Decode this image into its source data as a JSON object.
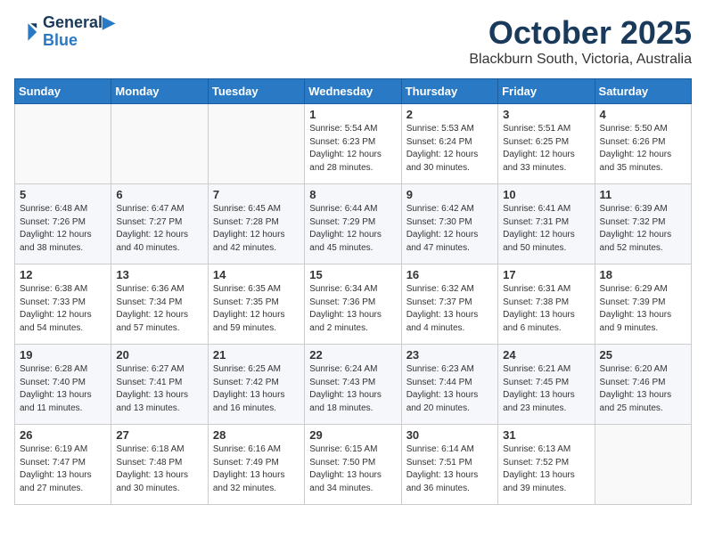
{
  "logo": {
    "line1": "General",
    "line2": "Blue"
  },
  "title": "October 2025",
  "location": "Blackburn South, Victoria, Australia",
  "weekdays": [
    "Sunday",
    "Monday",
    "Tuesday",
    "Wednesday",
    "Thursday",
    "Friday",
    "Saturday"
  ],
  "weeks": [
    [
      {
        "day": "",
        "info": ""
      },
      {
        "day": "",
        "info": ""
      },
      {
        "day": "",
        "info": ""
      },
      {
        "day": "1",
        "info": "Sunrise: 5:54 AM\nSunset: 6:23 PM\nDaylight: 12 hours\nand 28 minutes."
      },
      {
        "day": "2",
        "info": "Sunrise: 5:53 AM\nSunset: 6:24 PM\nDaylight: 12 hours\nand 30 minutes."
      },
      {
        "day": "3",
        "info": "Sunrise: 5:51 AM\nSunset: 6:25 PM\nDaylight: 12 hours\nand 33 minutes."
      },
      {
        "day": "4",
        "info": "Sunrise: 5:50 AM\nSunset: 6:26 PM\nDaylight: 12 hours\nand 35 minutes."
      }
    ],
    [
      {
        "day": "5",
        "info": "Sunrise: 6:48 AM\nSunset: 7:26 PM\nDaylight: 12 hours\nand 38 minutes."
      },
      {
        "day": "6",
        "info": "Sunrise: 6:47 AM\nSunset: 7:27 PM\nDaylight: 12 hours\nand 40 minutes."
      },
      {
        "day": "7",
        "info": "Sunrise: 6:45 AM\nSunset: 7:28 PM\nDaylight: 12 hours\nand 42 minutes."
      },
      {
        "day": "8",
        "info": "Sunrise: 6:44 AM\nSunset: 7:29 PM\nDaylight: 12 hours\nand 45 minutes."
      },
      {
        "day": "9",
        "info": "Sunrise: 6:42 AM\nSunset: 7:30 PM\nDaylight: 12 hours\nand 47 minutes."
      },
      {
        "day": "10",
        "info": "Sunrise: 6:41 AM\nSunset: 7:31 PM\nDaylight: 12 hours\nand 50 minutes."
      },
      {
        "day": "11",
        "info": "Sunrise: 6:39 AM\nSunset: 7:32 PM\nDaylight: 12 hours\nand 52 minutes."
      }
    ],
    [
      {
        "day": "12",
        "info": "Sunrise: 6:38 AM\nSunset: 7:33 PM\nDaylight: 12 hours\nand 54 minutes."
      },
      {
        "day": "13",
        "info": "Sunrise: 6:36 AM\nSunset: 7:34 PM\nDaylight: 12 hours\nand 57 minutes."
      },
      {
        "day": "14",
        "info": "Sunrise: 6:35 AM\nSunset: 7:35 PM\nDaylight: 12 hours\nand 59 minutes."
      },
      {
        "day": "15",
        "info": "Sunrise: 6:34 AM\nSunset: 7:36 PM\nDaylight: 13 hours\nand 2 minutes."
      },
      {
        "day": "16",
        "info": "Sunrise: 6:32 AM\nSunset: 7:37 PM\nDaylight: 13 hours\nand 4 minutes."
      },
      {
        "day": "17",
        "info": "Sunrise: 6:31 AM\nSunset: 7:38 PM\nDaylight: 13 hours\nand 6 minutes."
      },
      {
        "day": "18",
        "info": "Sunrise: 6:29 AM\nSunset: 7:39 PM\nDaylight: 13 hours\nand 9 minutes."
      }
    ],
    [
      {
        "day": "19",
        "info": "Sunrise: 6:28 AM\nSunset: 7:40 PM\nDaylight: 13 hours\nand 11 minutes."
      },
      {
        "day": "20",
        "info": "Sunrise: 6:27 AM\nSunset: 7:41 PM\nDaylight: 13 hours\nand 13 minutes."
      },
      {
        "day": "21",
        "info": "Sunrise: 6:25 AM\nSunset: 7:42 PM\nDaylight: 13 hours\nand 16 minutes."
      },
      {
        "day": "22",
        "info": "Sunrise: 6:24 AM\nSunset: 7:43 PM\nDaylight: 13 hours\nand 18 minutes."
      },
      {
        "day": "23",
        "info": "Sunrise: 6:23 AM\nSunset: 7:44 PM\nDaylight: 13 hours\nand 20 minutes."
      },
      {
        "day": "24",
        "info": "Sunrise: 6:21 AM\nSunset: 7:45 PM\nDaylight: 13 hours\nand 23 minutes."
      },
      {
        "day": "25",
        "info": "Sunrise: 6:20 AM\nSunset: 7:46 PM\nDaylight: 13 hours\nand 25 minutes."
      }
    ],
    [
      {
        "day": "26",
        "info": "Sunrise: 6:19 AM\nSunset: 7:47 PM\nDaylight: 13 hours\nand 27 minutes."
      },
      {
        "day": "27",
        "info": "Sunrise: 6:18 AM\nSunset: 7:48 PM\nDaylight: 13 hours\nand 30 minutes."
      },
      {
        "day": "28",
        "info": "Sunrise: 6:16 AM\nSunset: 7:49 PM\nDaylight: 13 hours\nand 32 minutes."
      },
      {
        "day": "29",
        "info": "Sunrise: 6:15 AM\nSunset: 7:50 PM\nDaylight: 13 hours\nand 34 minutes."
      },
      {
        "day": "30",
        "info": "Sunrise: 6:14 AM\nSunset: 7:51 PM\nDaylight: 13 hours\nand 36 minutes."
      },
      {
        "day": "31",
        "info": "Sunrise: 6:13 AM\nSunset: 7:52 PM\nDaylight: 13 hours\nand 39 minutes."
      },
      {
        "day": "",
        "info": ""
      }
    ]
  ]
}
